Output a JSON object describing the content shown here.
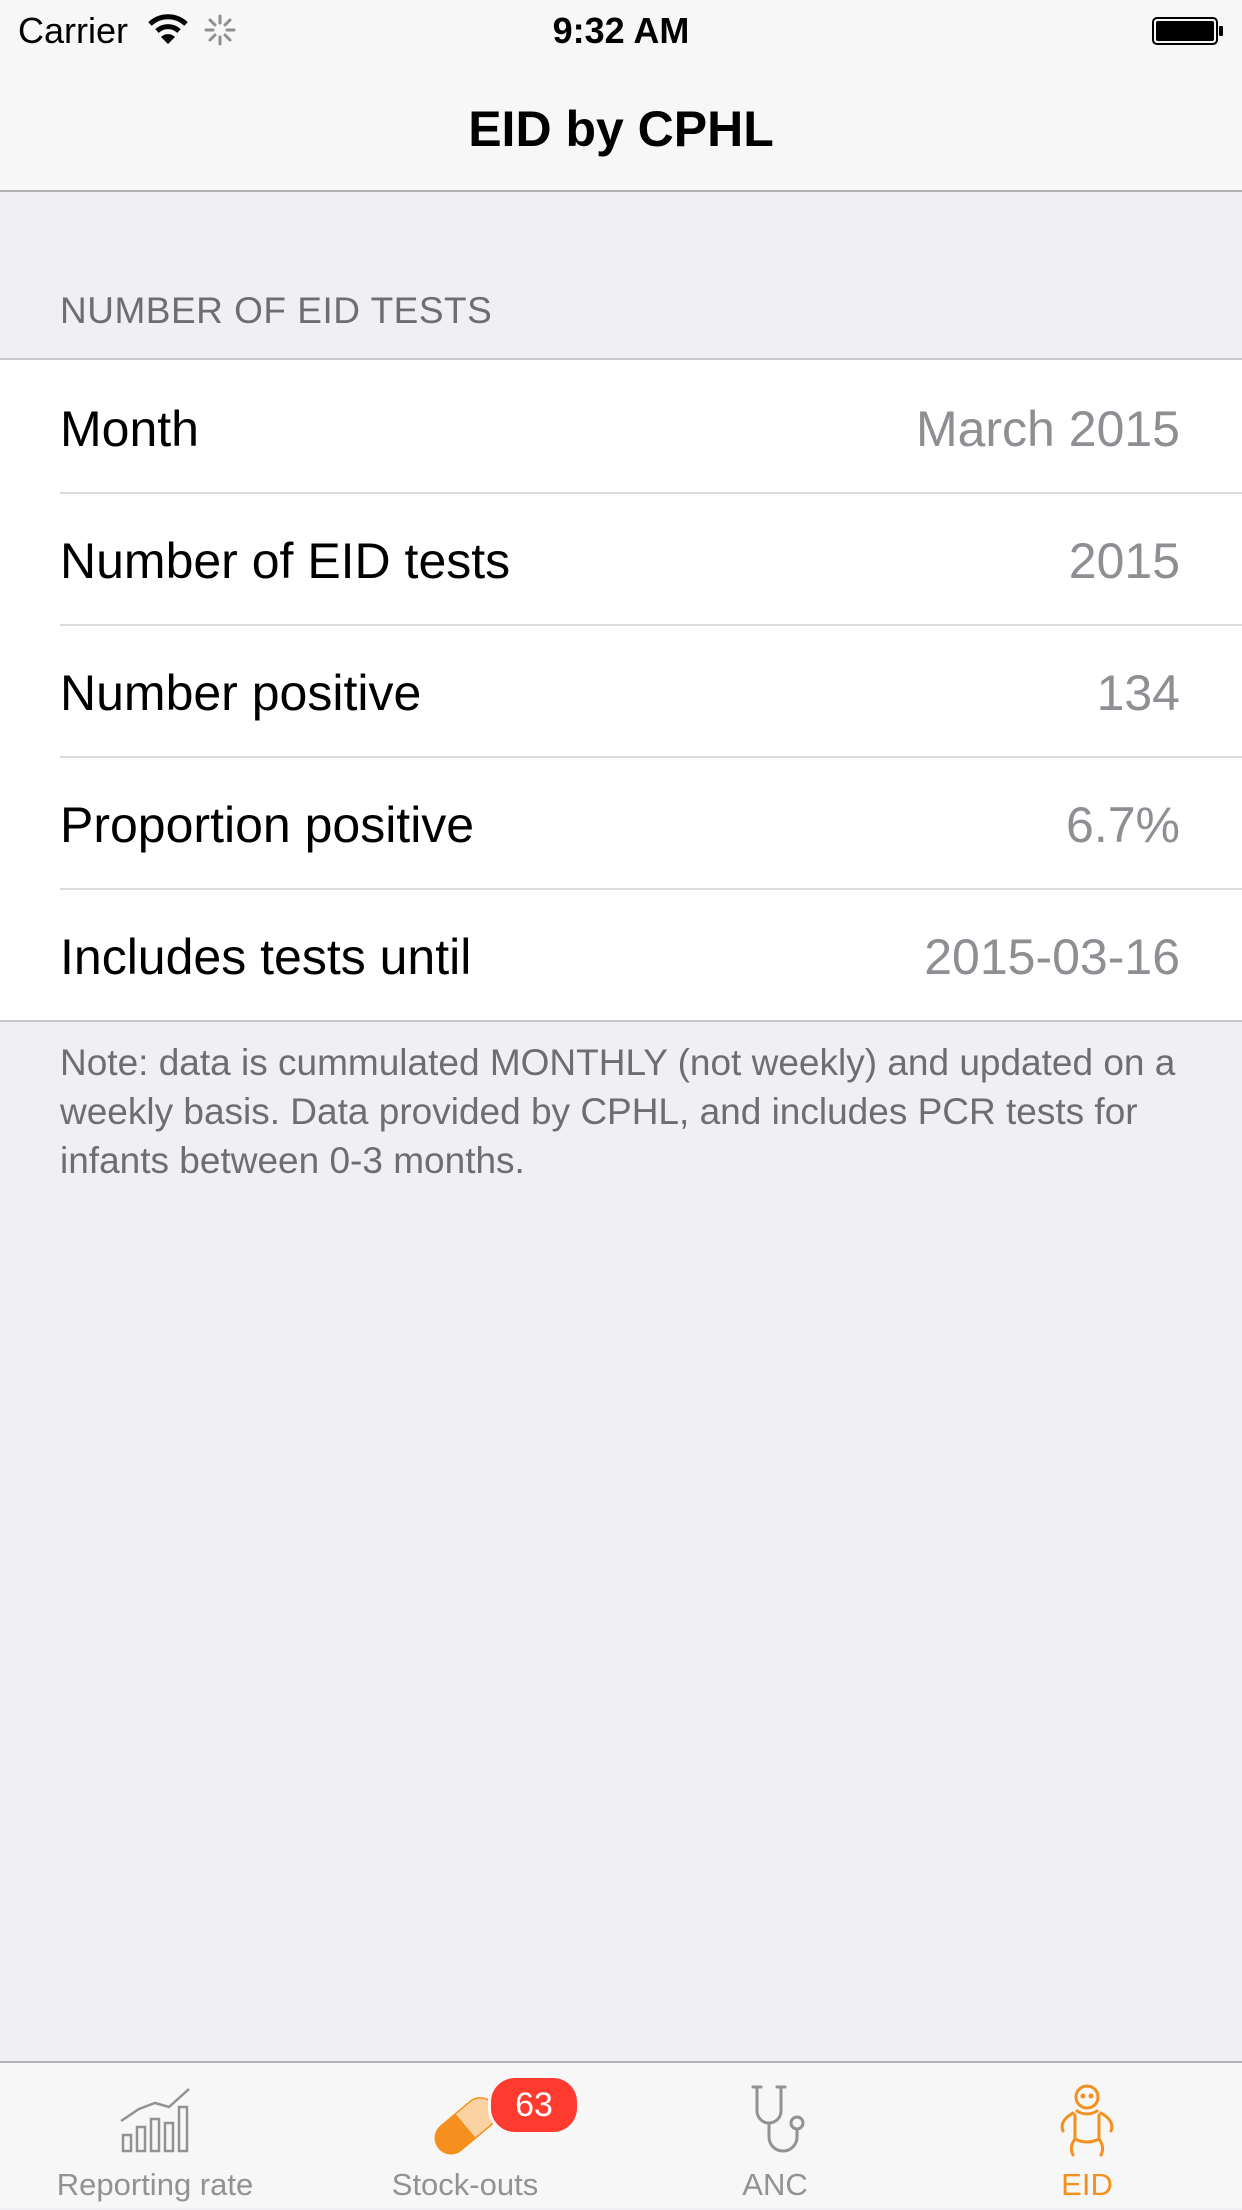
{
  "status_bar": {
    "carrier": "Carrier",
    "time": "9:32 AM",
    "icons": [
      "wifi-icon",
      "activity-spinner-icon",
      "battery-icon"
    ]
  },
  "nav": {
    "title": "EID by CPHL"
  },
  "section": {
    "header": "NUMBER OF EID TESTS",
    "rows": [
      {
        "label": "Month",
        "value": "March 2015"
      },
      {
        "label": "Number of EID tests",
        "value": "2015"
      },
      {
        "label": "Number positive",
        "value": "134"
      },
      {
        "label": "Proportion positive",
        "value": "6.7%"
      },
      {
        "label": "Includes tests until",
        "value": "2015-03-16"
      }
    ],
    "footnote": "Note: data is cummulated MONTHLY (not weekly) and updated on a weekly basis. Data provided by CPHL, and includes PCR tests for infants between 0-3 months."
  },
  "tab_bar": {
    "tabs": [
      {
        "label": "Reporting rate",
        "icon": "bar-chart-icon",
        "active": false
      },
      {
        "label": "Stock-outs",
        "icon": "pill-icon",
        "active": false,
        "badge": "63"
      },
      {
        "label": "ANC",
        "icon": "stethoscope-icon",
        "active": false
      },
      {
        "label": "EID",
        "icon": "baby-icon",
        "active": true
      }
    ]
  },
  "colors": {
    "accent": "#f5901f",
    "badge": "#ff3b30",
    "background": "#efeff4",
    "secondary_text": "#8e8e93"
  }
}
